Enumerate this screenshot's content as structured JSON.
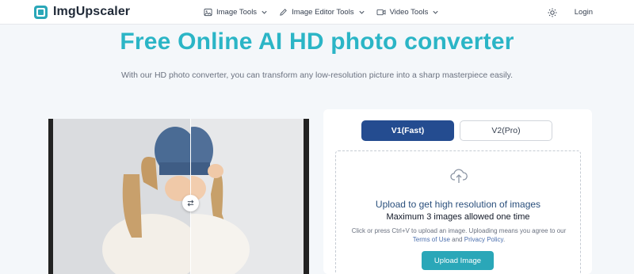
{
  "header": {
    "brand": "ImgUpscaler",
    "nav": [
      {
        "label": "Image Tools",
        "icon": "image-icon"
      },
      {
        "label": "Image Editor Tools",
        "icon": "pencil-icon"
      },
      {
        "label": "Video Tools",
        "icon": "video-icon"
      }
    ],
    "theme_icon": "sun-icon",
    "login_label": "Login"
  },
  "hero": {
    "title": "Free Online AI HD photo converter",
    "subtitle": "With our HD photo converter, you can transform any low-resolution picture into a sharp masterpiece easily."
  },
  "compare": {
    "swap_icon": "swap-arrows-icon"
  },
  "upload": {
    "tabs": [
      {
        "label": "V1(Fast)",
        "active": true
      },
      {
        "label": "V2(Pro)",
        "active": false
      }
    ],
    "icon": "cloud-upload-icon",
    "title": "Upload to get high resolution of images",
    "limit": "Maximum 3 images allowed one time",
    "note_prefix": "Click or press Ctrl+V to upload an image. Uploading means you agree to our",
    "terms_link": "Terms of Use",
    "note_and": "and",
    "privacy_link": "Privacy Policy",
    "note_suffix": ".",
    "button": "Upload Image"
  },
  "colors": {
    "accent": "#2bb5c6",
    "primary": "#244c90",
    "button": "#2aa7b8",
    "background": "#f4f7fa"
  }
}
